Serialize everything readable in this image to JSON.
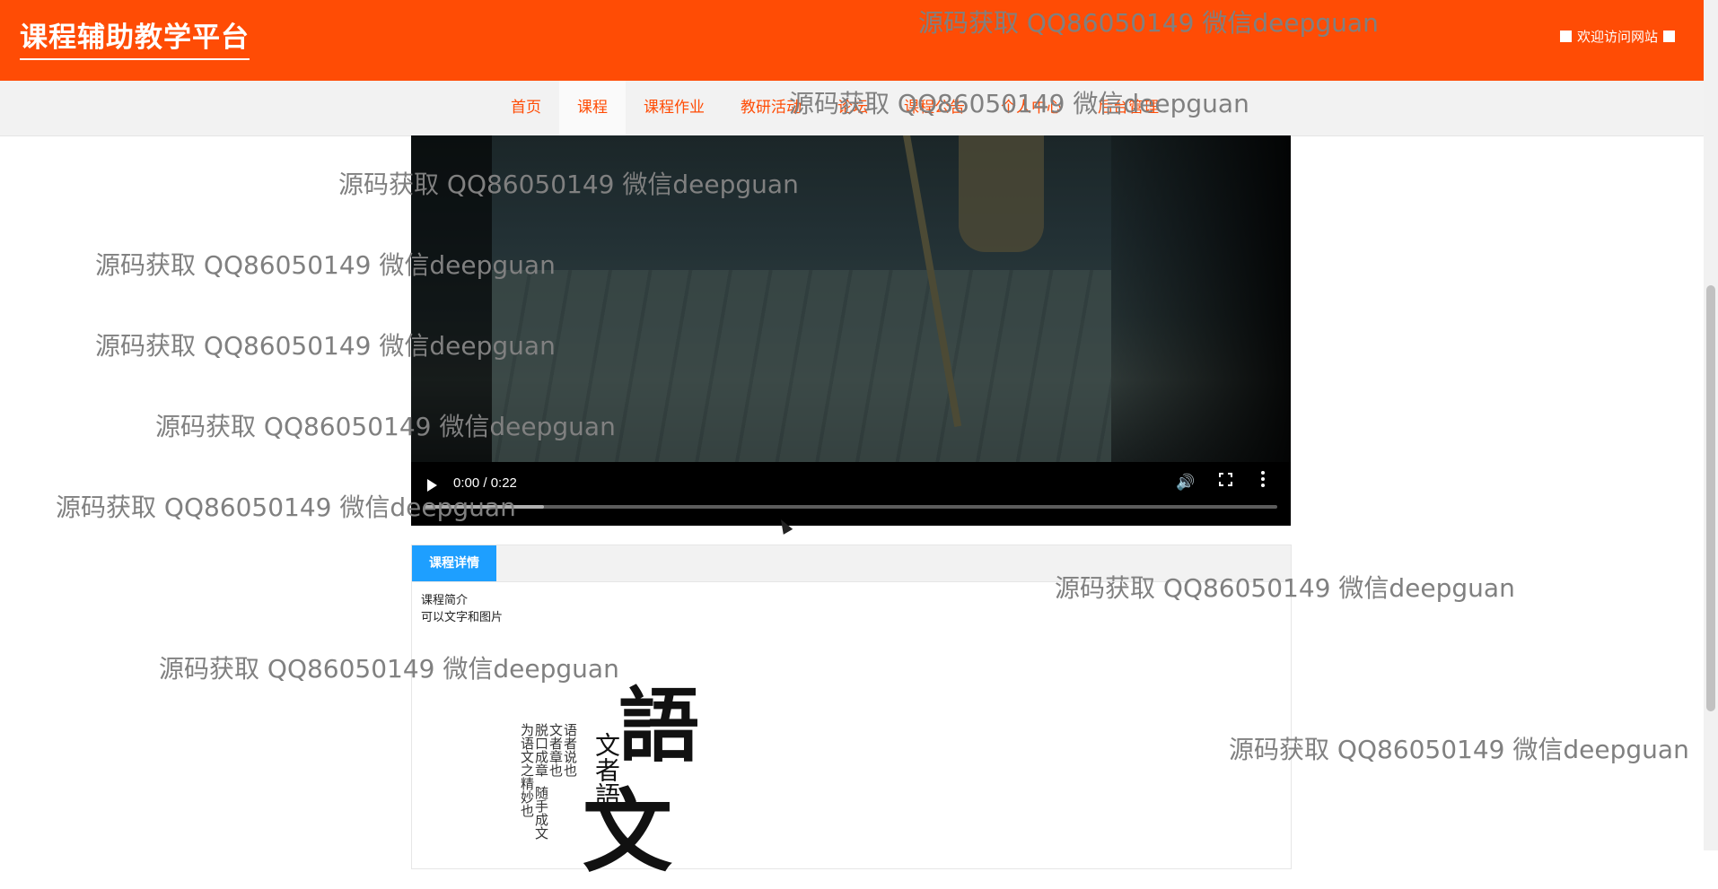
{
  "header": {
    "brand": "课程辅助教学平台",
    "welcome": "欢迎访问网站"
  },
  "nav": {
    "items": [
      "首页",
      "课程",
      "课程作业",
      "教研活动",
      "论坛",
      "课程公告",
      "个人中心",
      "后台管理"
    ],
    "active_index": 1
  },
  "video": {
    "time": "0:00 / 0:22",
    "buffered_fraction": 0.14
  },
  "details": {
    "tab_label": "课程详情",
    "intro_line1": "课程简介",
    "intro_line2": "可以文字和图片",
    "poster_char_top": "語",
    "poster_char_bottom": "文",
    "poster_mid": "文者語",
    "poster_col1": "语者说也",
    "poster_col2": "文者章也",
    "poster_col3": "脱口成章",
    "poster_col4": "随手成文",
    "poster_col5": "为语文之精妙也"
  },
  "watermark": {
    "text": "源码获取 QQ86050149 微信deepguan"
  },
  "colors": {
    "header_bg": "#ff4c05",
    "nav_text": "#ff4c05",
    "tab_bg": "#1e9fff"
  }
}
